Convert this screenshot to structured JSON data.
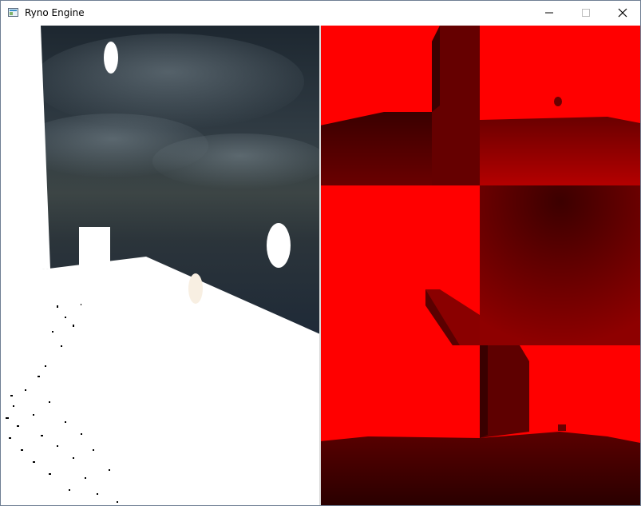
{
  "window": {
    "title": "Ryno Engine",
    "icon": "app-window-icon",
    "controls": {
      "minimize_icon": "minimize-icon",
      "maximize_icon": "maximize-icon",
      "close_icon": "close-icon"
    }
  },
  "viewport": {
    "left_pass": "final-lit-scene",
    "right_pass": "shadow-cubemap-faces",
    "colors": {
      "sky_top": "#1f2a33",
      "sky_horizon": "#3b4444",
      "ground_white": "#ffffff",
      "face_red": "#ff0000",
      "face_dark": "#5a0000"
    }
  }
}
